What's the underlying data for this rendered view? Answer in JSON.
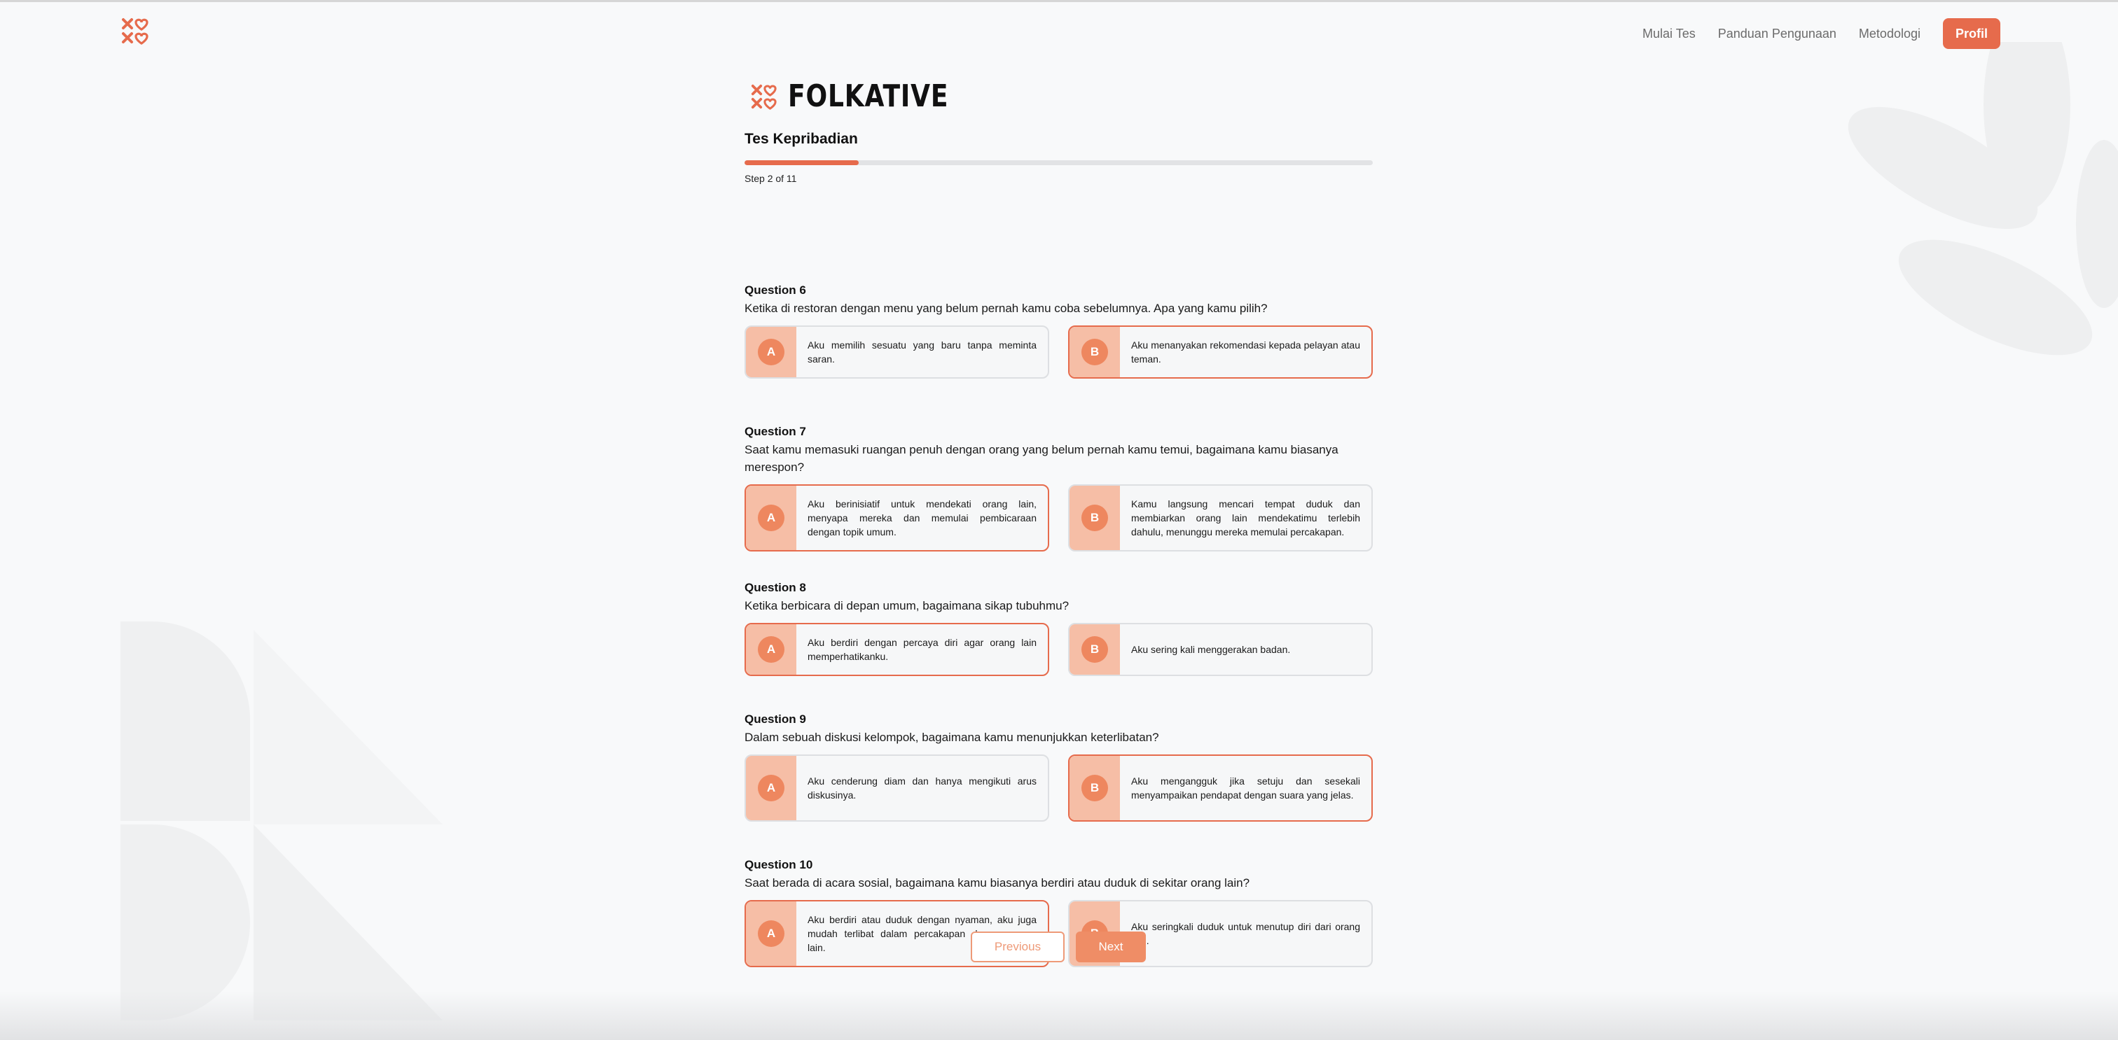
{
  "nav": {
    "links": [
      "Mulai Tes",
      "Panduan Pengunaan",
      "Metodologi"
    ],
    "profile_label": "Profil"
  },
  "brand": {
    "name": "FOLKATIVE"
  },
  "test": {
    "title": "Tes Kepribadian",
    "step_label": "Step 2 of 11",
    "progress_fraction": 0.182
  },
  "questions": [
    {
      "label": "Question 6",
      "text": "Ketika di restoran dengan menu yang belum pernah kamu coba sebelumnya. Apa yang kamu pilih?",
      "selected": "B",
      "options": [
        {
          "key": "A",
          "text": "Aku memilih sesuatu yang baru tanpa meminta saran."
        },
        {
          "key": "B",
          "text": "Aku menanyakan rekomendasi kepada pelayan atau teman."
        }
      ]
    },
    {
      "label": "Question 7",
      "text": "Saat kamu memasuki ruangan penuh dengan orang yang belum pernah kamu temui, bagaimana kamu biasanya merespon?",
      "selected": "A",
      "options": [
        {
          "key": "A",
          "text": "Aku berinisiatif untuk mendekati orang lain, menyapa mereka dan memulai pembicaraan dengan topik umum."
        },
        {
          "key": "B",
          "text": "Kamu langsung mencari tempat duduk dan membiarkan orang lain mendekatimu terlebih dahulu, menunggu mereka memulai percakapan."
        }
      ]
    },
    {
      "label": "Question 8",
      "text": "Ketika berbicara di depan umum, bagaimana sikap tubuhmu?",
      "selected": "A",
      "options": [
        {
          "key": "A",
          "text": "Aku berdiri dengan percaya diri agar orang lain memperhatikanku."
        },
        {
          "key": "B",
          "text": "Aku sering kali menggerakan badan."
        }
      ]
    },
    {
      "label": "Question 9",
      "text": "Dalam sebuah diskusi kelompok, bagaimana kamu menunjukkan keterlibatan?",
      "selected": "B",
      "options": [
        {
          "key": "A",
          "text": "Aku cenderung diam dan hanya mengikuti arus diskusinya."
        },
        {
          "key": "B",
          "text": "Aku mengangguk jika setuju dan sesekali menyampaikan pendapat dengan suara yang jelas."
        }
      ]
    },
    {
      "label": "Question 10",
      "text": "Saat berada di acara sosial, bagaimana kamu biasanya berdiri atau duduk di sekitar orang lain?",
      "selected": "A",
      "options": [
        {
          "key": "A",
          "text": "Aku berdiri atau duduk dengan nyaman, aku juga mudah terlibat dalam percakapan dengan orang lain."
        },
        {
          "key": "B",
          "text": "Aku seringkali duduk untuk menutup diri dari orang lain."
        }
      ]
    }
  ],
  "pagination": {
    "previous_label": "Previous",
    "next_label": "Next"
  },
  "colors": {
    "accent": "#e66b4c",
    "badge": "#ee875f",
    "badge_bg": "#f6bea6",
    "next_button": "#ef8d66"
  }
}
